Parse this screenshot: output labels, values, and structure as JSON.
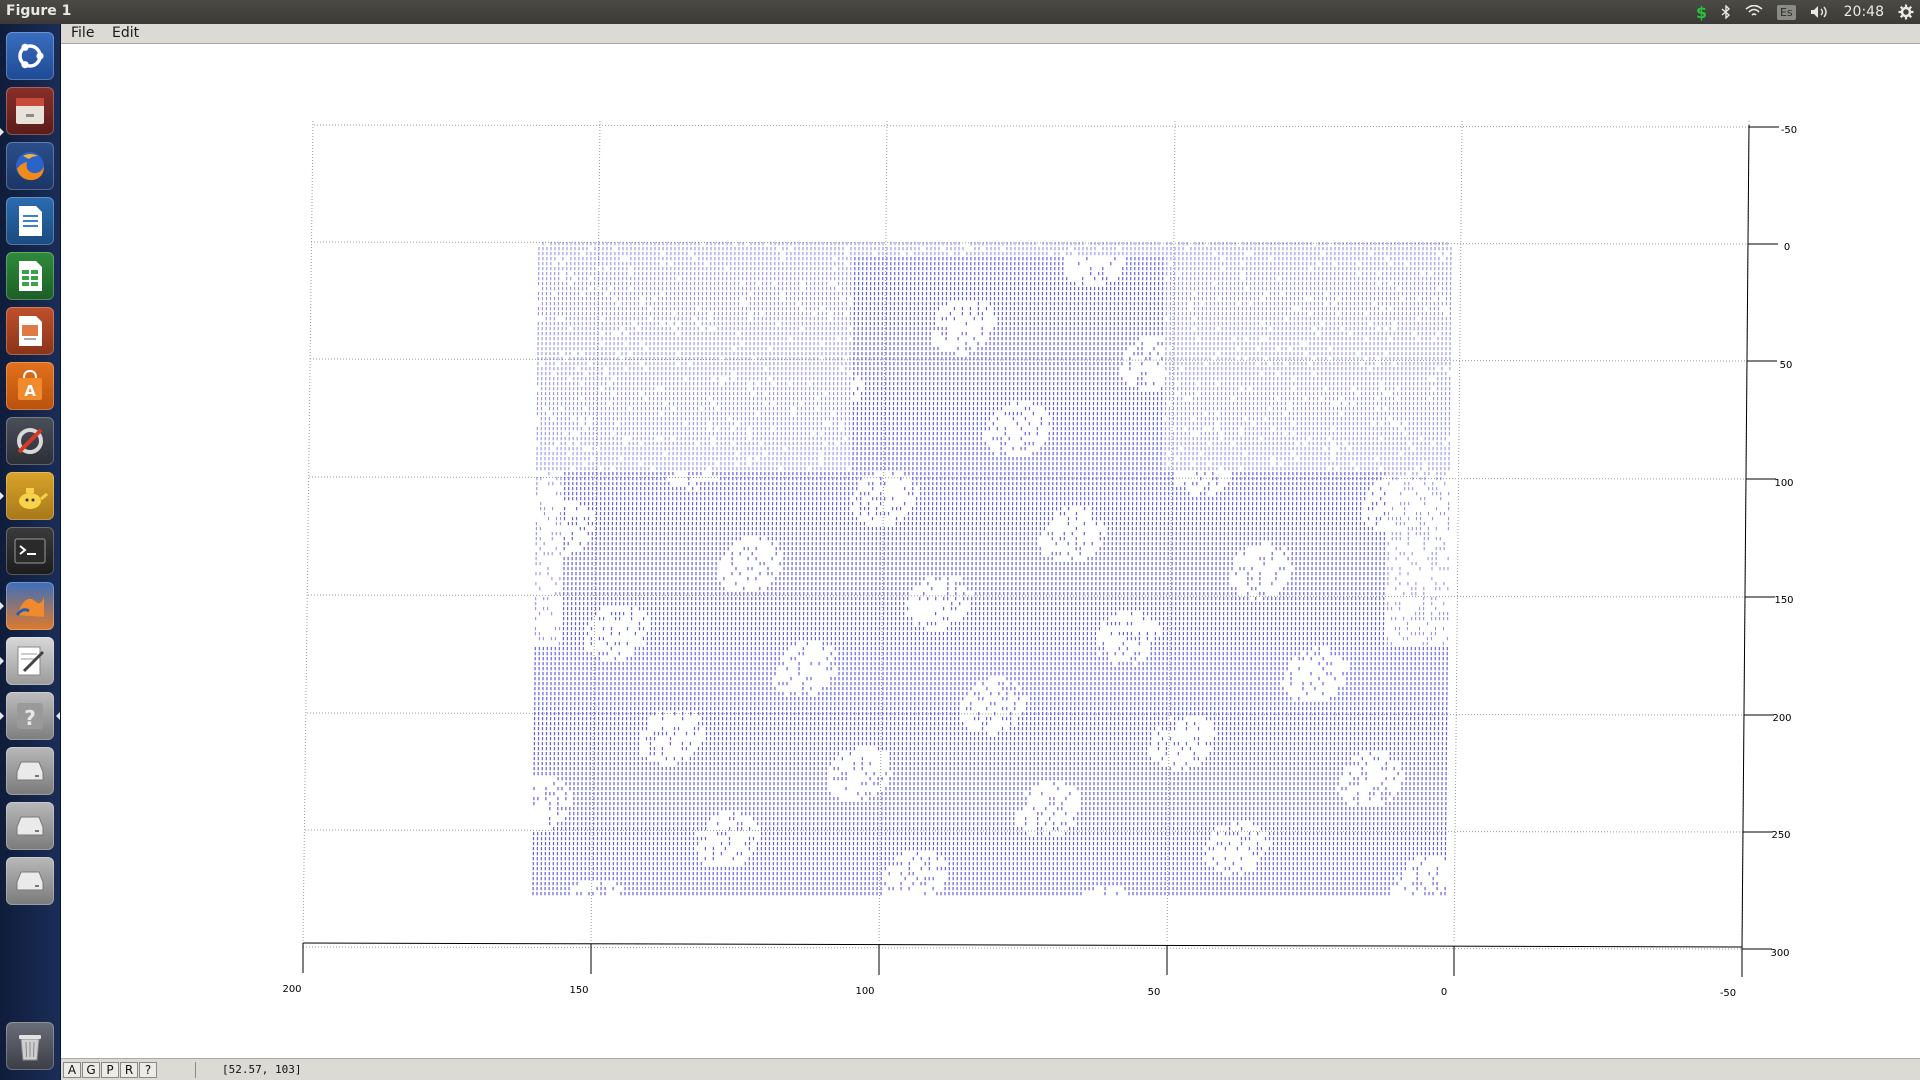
{
  "window": {
    "title": "Figure 1"
  },
  "tray": {
    "time": "20:48",
    "keyboard_layout": "Es",
    "icons": [
      "dollar-icon",
      "bluetooth-icon",
      "wifi-icon",
      "keyboard-icon",
      "volume-icon",
      "gear-icon"
    ]
  },
  "launcher": {
    "items": [
      {
        "name": "ubuntu-dash",
        "icon": "ubuntu-logo-icon"
      },
      {
        "name": "files",
        "icon": "file-cabinet-icon"
      },
      {
        "name": "firefox",
        "icon": "firefox-icon"
      },
      {
        "name": "writer",
        "icon": "document-icon"
      },
      {
        "name": "calc",
        "icon": "spreadsheet-icon"
      },
      {
        "name": "impress",
        "icon": "presentation-icon"
      },
      {
        "name": "software-center",
        "icon": "shopping-bag-icon"
      },
      {
        "name": "system-settings",
        "icon": "wrench-icon"
      },
      {
        "name": "teapot-app",
        "icon": "teapot-icon"
      },
      {
        "name": "terminal",
        "icon": "terminal-icon"
      },
      {
        "name": "matlab-like",
        "icon": "orange-app-icon"
      },
      {
        "name": "text-editor",
        "icon": "pencil-icon"
      },
      {
        "name": "help",
        "icon": "question-icon"
      },
      {
        "name": "drive-1",
        "icon": "drive-icon"
      },
      {
        "name": "drive-2",
        "icon": "drive-icon"
      },
      {
        "name": "drive-3",
        "icon": "drive-icon"
      },
      {
        "name": "trash",
        "icon": "trash-icon"
      }
    ]
  },
  "menubar": {
    "file": "File",
    "edit": "Edit"
  },
  "plot": {
    "point_color": "#3b3bdd",
    "x_ticks": [
      "200",
      "150",
      "100",
      "50",
      "0",
      "-50"
    ],
    "y_ticks": [
      "-50",
      "0",
      "50",
      "100",
      "150",
      "200",
      "250",
      "300"
    ]
  },
  "statusbar": {
    "buttons": [
      "A",
      "G",
      "P",
      "R",
      "?"
    ],
    "coords": "[52.57, 103]"
  }
}
